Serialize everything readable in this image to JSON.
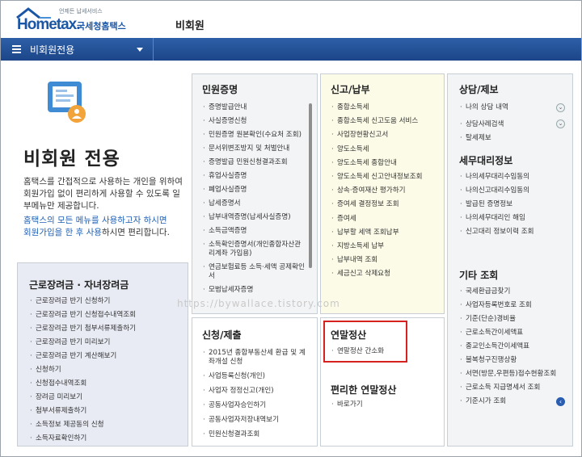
{
  "header": {
    "logo_main": "Hometax.",
    "logo_sub": "국세청홈택스",
    "logo_tag": "언제든 납세서비스",
    "page_heading": "비회원"
  },
  "nav": {
    "label": "비회원전용"
  },
  "intro": {
    "title": "비회원 전용",
    "desc": "홈택스를 간접적으로 사용하는 개인을 위하여 회원가입 없이 편리하게 사용할 수 있도록 일부메뉴만 제공합니다.",
    "desc2_blue1": "홈택스의 모든 메뉴를 사용하고자 하시면",
    "desc2_blue2": "회원가입을 한 후 사용",
    "desc2_tail": "하시면 편리합니다."
  },
  "panels": {
    "minwon": {
      "title": "민원증명",
      "items": [
        "증명발급안내",
        "사실증명신청",
        "민원증명 원본확인(수요처 조회)",
        "문서위변조방지 및 처벌안내",
        "증명발급 민원신청결과조회",
        "휴업사실증명",
        "폐업사실증명",
        "납세증명서",
        "납부내역증명(납세사실증명)",
        "소득금액증명",
        "소득확인증명서(개인종합자산관리계좌 가입용)",
        "연금보험료등 소득·세액 공제확인서",
        "모범납세자증명"
      ]
    },
    "shingo": {
      "title": "신고/납부",
      "items": [
        "종합소득세",
        "종합소득세 신고도움 서비스",
        "사업장현황신고서",
        "양도소득세",
        "양도소득세 종합안내",
        "양도소득세 신고안내정보조회",
        "상속·증여재산 평가하기",
        "증여세 결정정보 조회",
        "증여세",
        "납부할 세액 조회납부",
        "지방소득세 납부",
        "납부내역 조회",
        "세금신고 삭제요청"
      ]
    },
    "sangdam": {
      "title": "상담/제보",
      "items": [
        "나의 상담 내역",
        "상담사례검색",
        "탈세제보"
      ]
    },
    "semu": {
      "title": "세무대리정보",
      "items": [
        "나의세무대리수임동의",
        "나의신고대리수임동의",
        "발급된 증명정보",
        "나의세무대리인 해임",
        "신고대리 정보이력 조회"
      ]
    },
    "gita": {
      "title": "기타 조회",
      "items": [
        "국세환급금찾기",
        "사업자등록번호로 조회",
        "기준(단순)경비율",
        "근로소득간이세액표",
        "종교인소득간이세액표",
        "불복청구진행상황",
        "서면(방문,우편등)접수현황조회",
        "근로소득 지급명세서 조회",
        "기준시가 조회"
      ]
    },
    "geullo": {
      "title": "근로장려금 · 자녀장려금",
      "items": [
        "근로장려금 반기 신청하기",
        "근로장려금 반기 신청접수내역조회",
        "근로장려금 반기 첨부서류제출하기",
        "근로장려금 반기 미리보기",
        "근로장려금 반기 계산해보기",
        "신청하기",
        "신청접수내역조회",
        "장려금 미리보기",
        "첨부서류제출하기",
        "소득정보 제공동의 신청",
        "소득자료확인하기"
      ]
    },
    "sincheong": {
      "title": "신청/제출",
      "items": [
        "2015년 종합부동산세 환급 및 계좌개설 신청",
        "사업등록신청(개인)",
        "사업자 정정신고(개인)",
        "공동사업자승인하기",
        "공동사업자저장내역보기",
        "민원신청결과조회"
      ]
    },
    "yeonmal": {
      "title": "연말정산",
      "items": [
        "연말정산 간소화"
      ]
    },
    "pyeonri": {
      "title": "편리한 연말정산",
      "items": [
        "바로가기"
      ]
    }
  },
  "watermark": "https://bywallace.tistory.com",
  "colors": {
    "brand": "#1a56a6",
    "nav": "#1c4688",
    "highlight": "#d6221f"
  }
}
